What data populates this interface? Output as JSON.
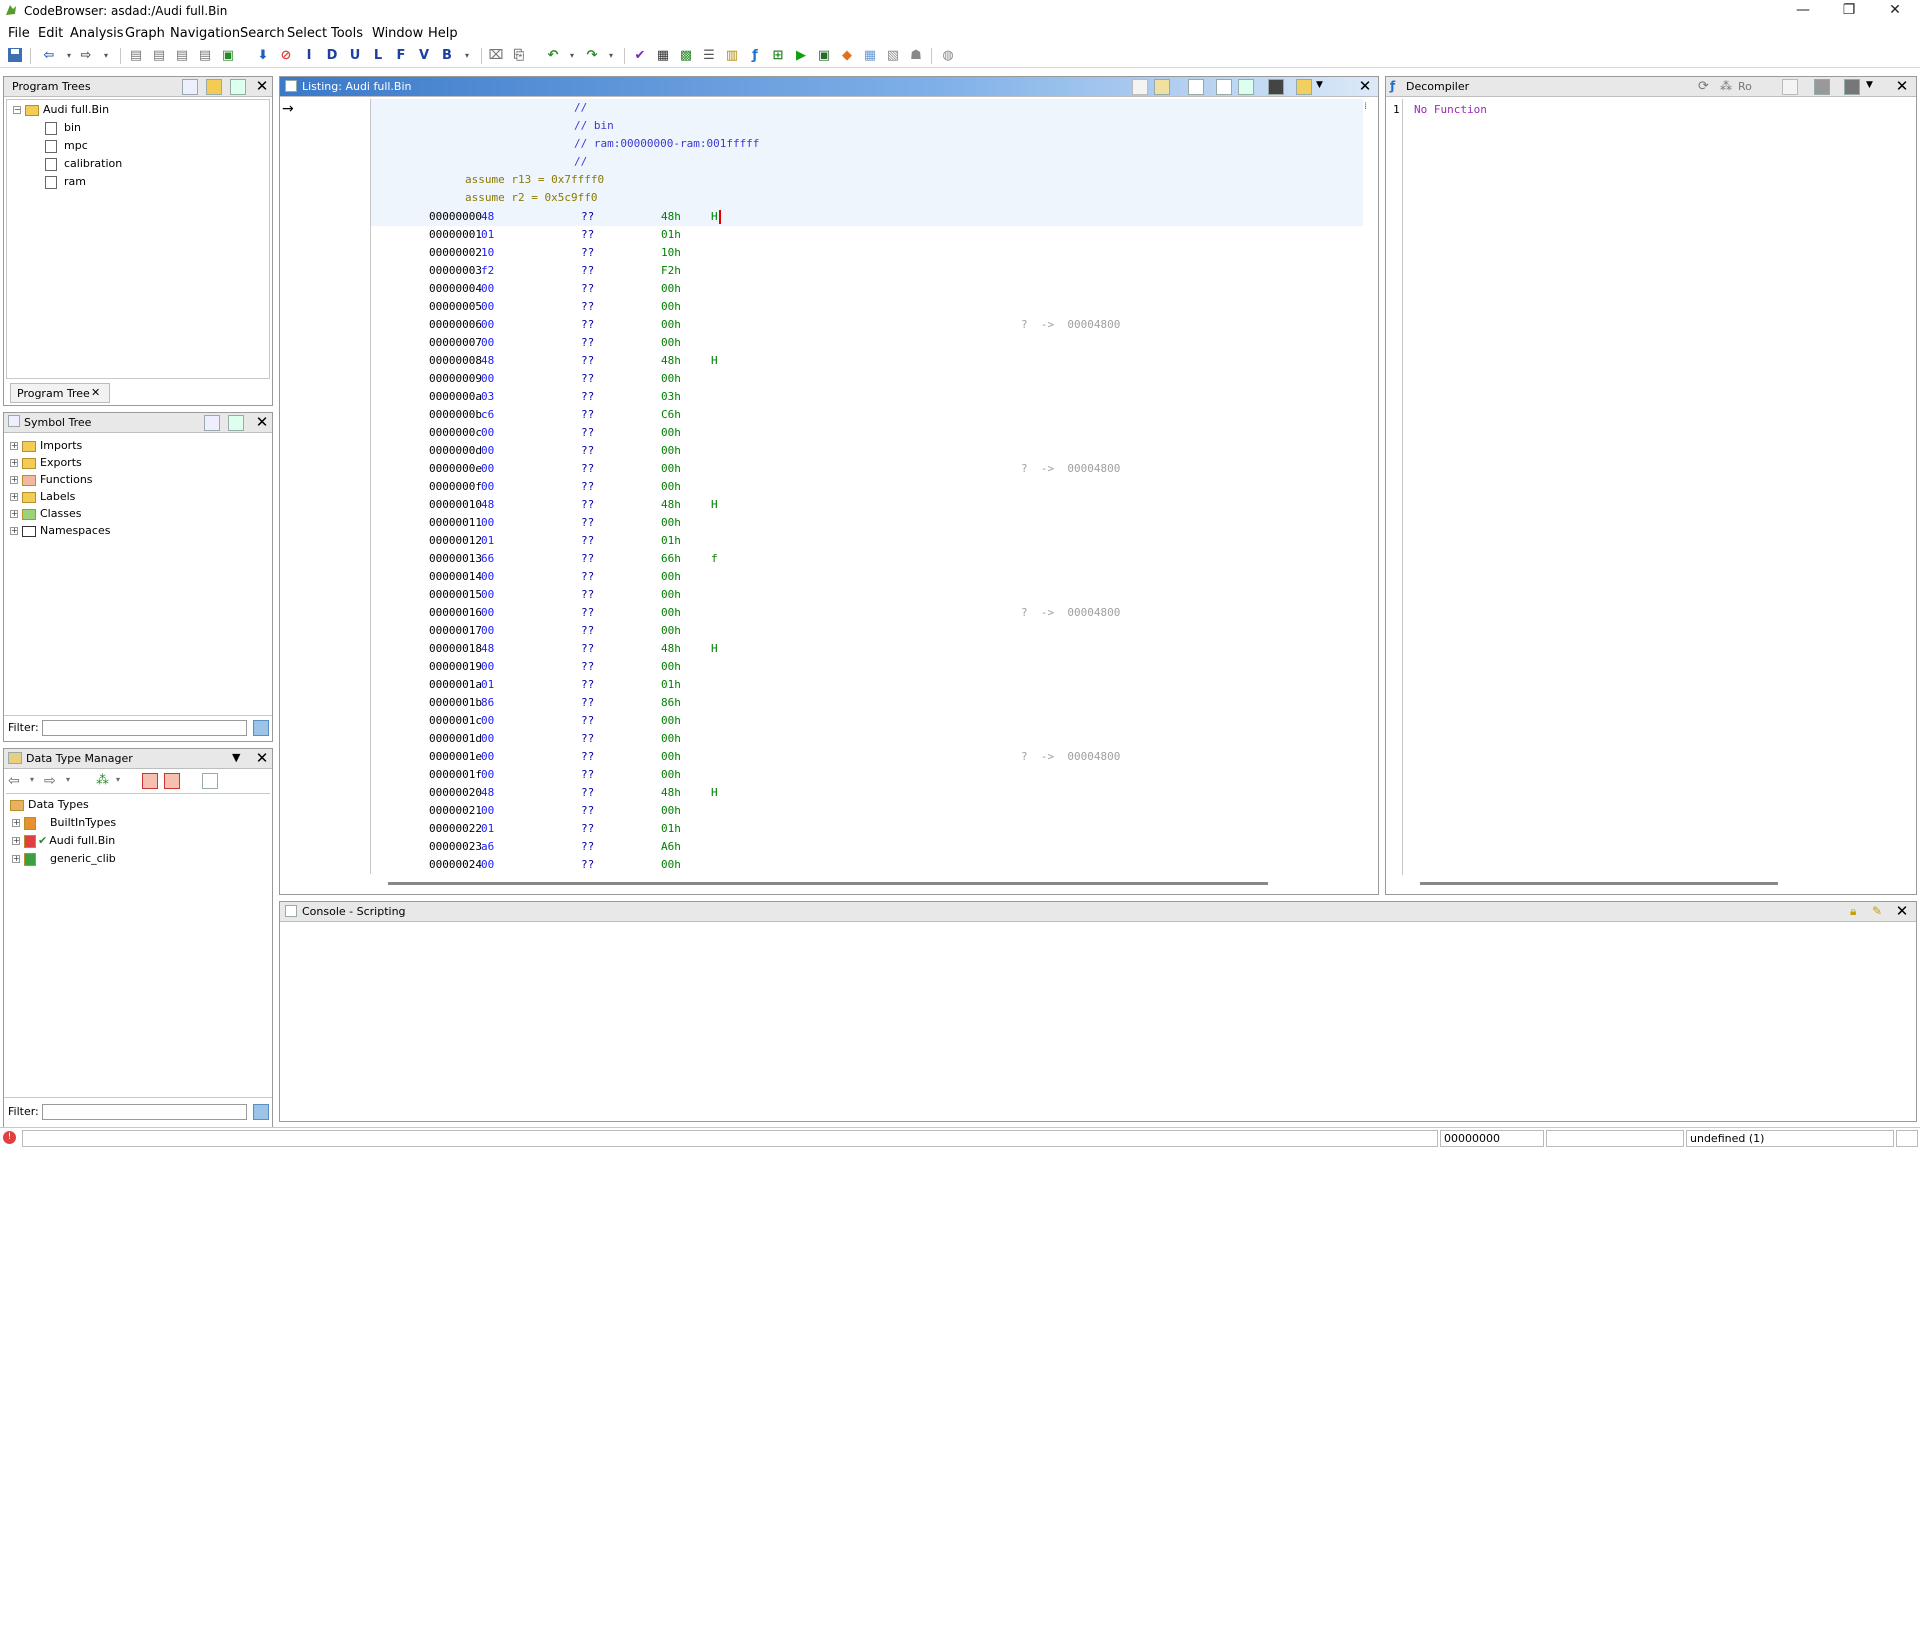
{
  "window": {
    "title": "CodeBrowser: asdad:/Audi full.Bin",
    "controls": [
      "—",
      "❐",
      "✕"
    ]
  },
  "menubar": [
    "File",
    "Edit",
    "Analysis",
    "Graph",
    "Navigation",
    "Search",
    "Select",
    "Tools",
    "Window",
    "Help"
  ],
  "toolbar": {
    "letters": [
      "I",
      "D",
      "U",
      "L",
      "F",
      "V",
      "B"
    ]
  },
  "program_trees": {
    "title": "Program Trees",
    "root": "Audi full.Bin",
    "children": [
      "bin",
      "mpc",
      "calibration",
      "ram"
    ],
    "tab": "Program Tree"
  },
  "symbol_tree": {
    "title": "Symbol Tree",
    "items": [
      "Imports",
      "Exports",
      "Functions",
      "Labels",
      "Classes",
      "Namespaces"
    ],
    "filter_label": "Filter:"
  },
  "data_type_manager": {
    "title": "Data Type Manager",
    "root": "Data Types",
    "items": [
      "BuiltInTypes",
      "Audi full.Bin",
      "generic_clib"
    ],
    "filter_label": "Filter:"
  },
  "listing": {
    "title": "Listing:  Audi full.Bin",
    "header_comments": [
      "//",
      "// bin",
      "// ram:00000000-ram:001fffff",
      "//"
    ],
    "assumes": [
      "assume r13 = 0x7ffff0",
      "assume r2 = 0x5c9ff0"
    ],
    "rows": [
      {
        "addr": "00000000",
        "byte": "48",
        "q": "??",
        "val": "48h",
        "chr": "H",
        "ref": ""
      },
      {
        "addr": "00000001",
        "byte": "01",
        "q": "??",
        "val": "01h",
        "chr": "",
        "ref": ""
      },
      {
        "addr": "00000002",
        "byte": "10",
        "q": "??",
        "val": "10h",
        "chr": "",
        "ref": ""
      },
      {
        "addr": "00000003",
        "byte": "f2",
        "q": "??",
        "val": "F2h",
        "chr": "",
        "ref": ""
      },
      {
        "addr": "00000004",
        "byte": "00",
        "q": "??",
        "val": "00h",
        "chr": "",
        "ref": ""
      },
      {
        "addr": "00000005",
        "byte": "00",
        "q": "??",
        "val": "00h",
        "chr": "",
        "ref": ""
      },
      {
        "addr": "00000006",
        "byte": "00",
        "q": "??",
        "val": "00h",
        "chr": "",
        "ref": "?  ->  00004800"
      },
      {
        "addr": "00000007",
        "byte": "00",
        "q": "??",
        "val": "00h",
        "chr": "",
        "ref": ""
      },
      {
        "addr": "00000008",
        "byte": "48",
        "q": "??",
        "val": "48h",
        "chr": "H",
        "ref": ""
      },
      {
        "addr": "00000009",
        "byte": "00",
        "q": "??",
        "val": "00h",
        "chr": "",
        "ref": ""
      },
      {
        "addr": "0000000a",
        "byte": "03",
        "q": "??",
        "val": "03h",
        "chr": "",
        "ref": ""
      },
      {
        "addr": "0000000b",
        "byte": "c6",
        "q": "??",
        "val": "C6h",
        "chr": "",
        "ref": ""
      },
      {
        "addr": "0000000c",
        "byte": "00",
        "q": "??",
        "val": "00h",
        "chr": "",
        "ref": ""
      },
      {
        "addr": "0000000d",
        "byte": "00",
        "q": "??",
        "val": "00h",
        "chr": "",
        "ref": ""
      },
      {
        "addr": "0000000e",
        "byte": "00",
        "q": "??",
        "val": "00h",
        "chr": "",
        "ref": "?  ->  00004800"
      },
      {
        "addr": "0000000f",
        "byte": "00",
        "q": "??",
        "val": "00h",
        "chr": "",
        "ref": ""
      },
      {
        "addr": "00000010",
        "byte": "48",
        "q": "??",
        "val": "48h",
        "chr": "H",
        "ref": ""
      },
      {
        "addr": "00000011",
        "byte": "00",
        "q": "??",
        "val": "00h",
        "chr": "",
        "ref": ""
      },
      {
        "addr": "00000012",
        "byte": "01",
        "q": "??",
        "val": "01h",
        "chr": "",
        "ref": ""
      },
      {
        "addr": "00000013",
        "byte": "66",
        "q": "??",
        "val": "66h",
        "chr": "f",
        "ref": ""
      },
      {
        "addr": "00000014",
        "byte": "00",
        "q": "??",
        "val": "00h",
        "chr": "",
        "ref": ""
      },
      {
        "addr": "00000015",
        "byte": "00",
        "q": "??",
        "val": "00h",
        "chr": "",
        "ref": ""
      },
      {
        "addr": "00000016",
        "byte": "00",
        "q": "??",
        "val": "00h",
        "chr": "",
        "ref": "?  ->  00004800"
      },
      {
        "addr": "00000017",
        "byte": "00",
        "q": "??",
        "val": "00h",
        "chr": "",
        "ref": ""
      },
      {
        "addr": "00000018",
        "byte": "48",
        "q": "??",
        "val": "48h",
        "chr": "H",
        "ref": ""
      },
      {
        "addr": "00000019",
        "byte": "00",
        "q": "??",
        "val": "00h",
        "chr": "",
        "ref": ""
      },
      {
        "addr": "0000001a",
        "byte": "01",
        "q": "??",
        "val": "01h",
        "chr": "",
        "ref": ""
      },
      {
        "addr": "0000001b",
        "byte": "86",
        "q": "??",
        "val": "86h",
        "chr": "",
        "ref": ""
      },
      {
        "addr": "0000001c",
        "byte": "00",
        "q": "??",
        "val": "00h",
        "chr": "",
        "ref": ""
      },
      {
        "addr": "0000001d",
        "byte": "00",
        "q": "??",
        "val": "00h",
        "chr": "",
        "ref": ""
      },
      {
        "addr": "0000001e",
        "byte": "00",
        "q": "??",
        "val": "00h",
        "chr": "",
        "ref": "?  ->  00004800"
      },
      {
        "addr": "0000001f",
        "byte": "00",
        "q": "??",
        "val": "00h",
        "chr": "",
        "ref": ""
      },
      {
        "addr": "00000020",
        "byte": "48",
        "q": "??",
        "val": "48h",
        "chr": "H",
        "ref": ""
      },
      {
        "addr": "00000021",
        "byte": "00",
        "q": "??",
        "val": "00h",
        "chr": "",
        "ref": ""
      },
      {
        "addr": "00000022",
        "byte": "01",
        "q": "??",
        "val": "01h",
        "chr": "",
        "ref": ""
      },
      {
        "addr": "00000023",
        "byte": "a6",
        "q": "??",
        "val": "A6h",
        "chr": "",
        "ref": ""
      },
      {
        "addr": "00000024",
        "byte": "00",
        "q": "??",
        "val": "00h",
        "chr": "",
        "ref": ""
      }
    ]
  },
  "decompiler": {
    "title": "Decompiler",
    "head_label": "Ro",
    "line_no": "1",
    "text": "No Function"
  },
  "console": {
    "title": "Console - Scripting"
  },
  "statusbar": {
    "address": "00000000",
    "type": "undefined  (1)"
  }
}
